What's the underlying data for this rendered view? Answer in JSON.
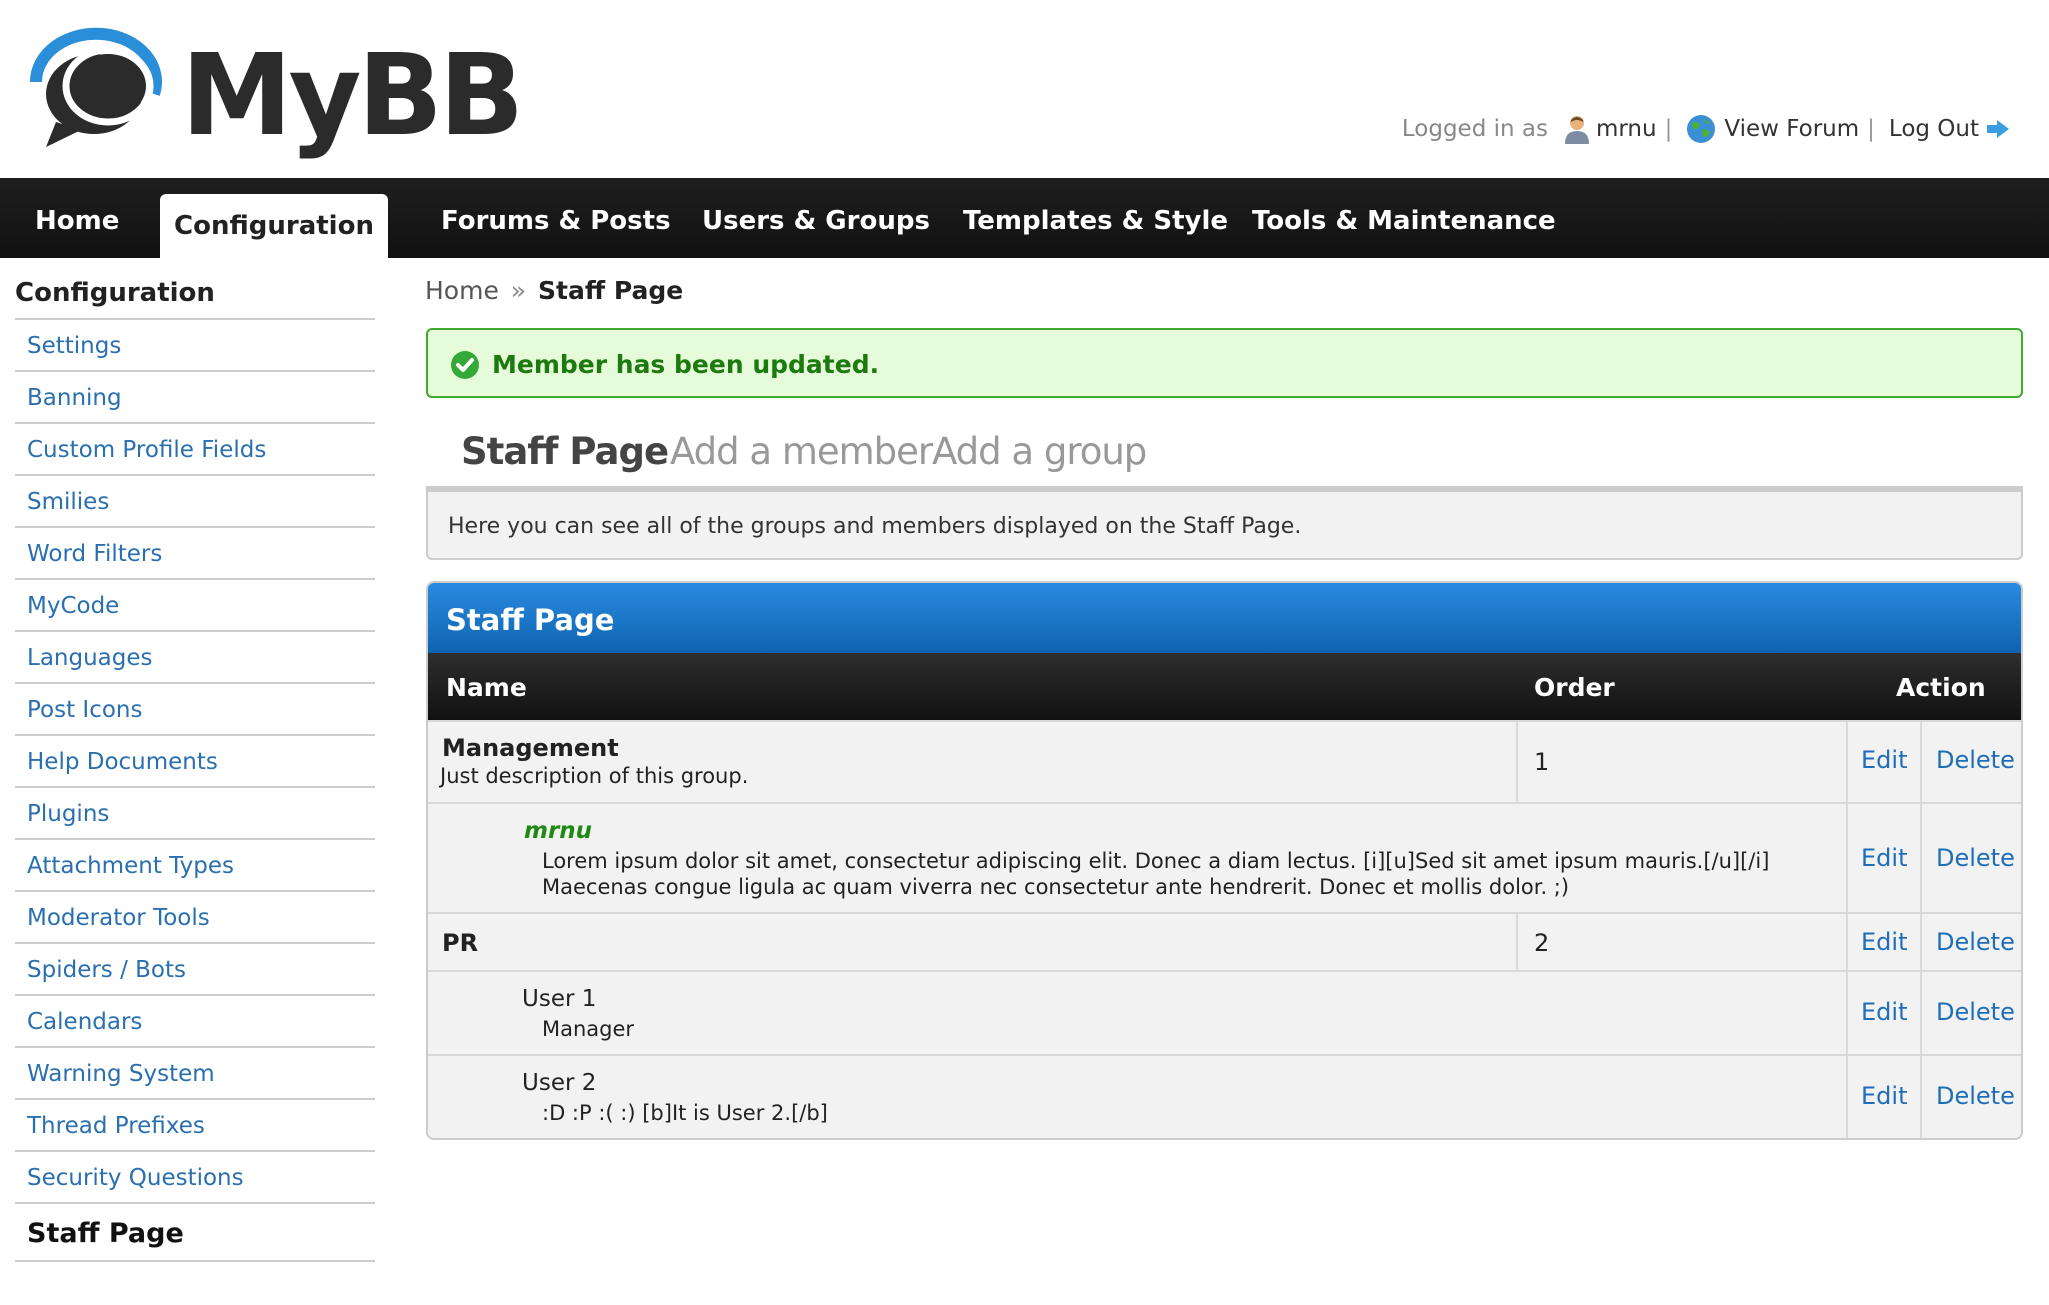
{
  "header": {
    "logo_text": "MyBB",
    "logged_in_label": "Logged in as",
    "username": "mrnu",
    "view_forum": "View Forum",
    "log_out": "Log Out",
    "separator": "|"
  },
  "menu": {
    "items": [
      "Home",
      "Configuration",
      "Forums & Posts",
      "Users & Groups",
      "Templates & Style",
      "Tools & Maintenance"
    ],
    "active": "Configuration"
  },
  "sidebar": {
    "title": "Configuration",
    "items": [
      "Settings",
      "Banning",
      "Custom Profile Fields",
      "Smilies",
      "Word Filters",
      "MyCode",
      "Languages",
      "Post Icons",
      "Help Documents",
      "Plugins",
      "Attachment Types",
      "Moderator Tools",
      "Spiders / Bots",
      "Calendars",
      "Warning System",
      "Thread Prefixes",
      "Security Questions",
      "Staff Page"
    ],
    "active": "Staff Page"
  },
  "breadcrumb": {
    "home": "Home",
    "sep": "»",
    "current": "Staff Page"
  },
  "alert": {
    "message": "Member has been updated."
  },
  "tabs": {
    "items": [
      "Staff Page",
      "Add a member",
      "Add a group"
    ],
    "description": "Here you can see all of the groups and members displayed on the Staff Page."
  },
  "table": {
    "title": "Staff Page",
    "headers": {
      "name": "Name",
      "order": "Order",
      "action": "Action"
    },
    "edit_label": "Edit",
    "delete_label": "Delete",
    "groups": [
      {
        "name": "Management",
        "description": "Just description of this group.",
        "order": "1"
      },
      {
        "name": "PR",
        "order": "2"
      }
    ],
    "members": [
      {
        "name": "mrnu",
        "line1": "Lorem ipsum dolor sit amet, consectetur adipiscing elit. Donec a diam lectus. [i][u]Sed sit amet ipsum mauris.[/u][/i]",
        "line2": "Maecenas congue ligula ac quam viverra nec consectetur ante hendrerit. Donec et mollis dolor. ;)"
      },
      {
        "name": "User 1",
        "line1": "Manager"
      },
      {
        "name": "User 2",
        "line1": ":D :P :( :) [b]It is User 2.[/b]"
      }
    ]
  },
  "colors": {
    "link": "#1e6eb8",
    "success_bg": "#e6fbd9",
    "success_border": "#3fab2f",
    "table_title": "#1572c8",
    "menu_bg": "#1a1a1a"
  }
}
